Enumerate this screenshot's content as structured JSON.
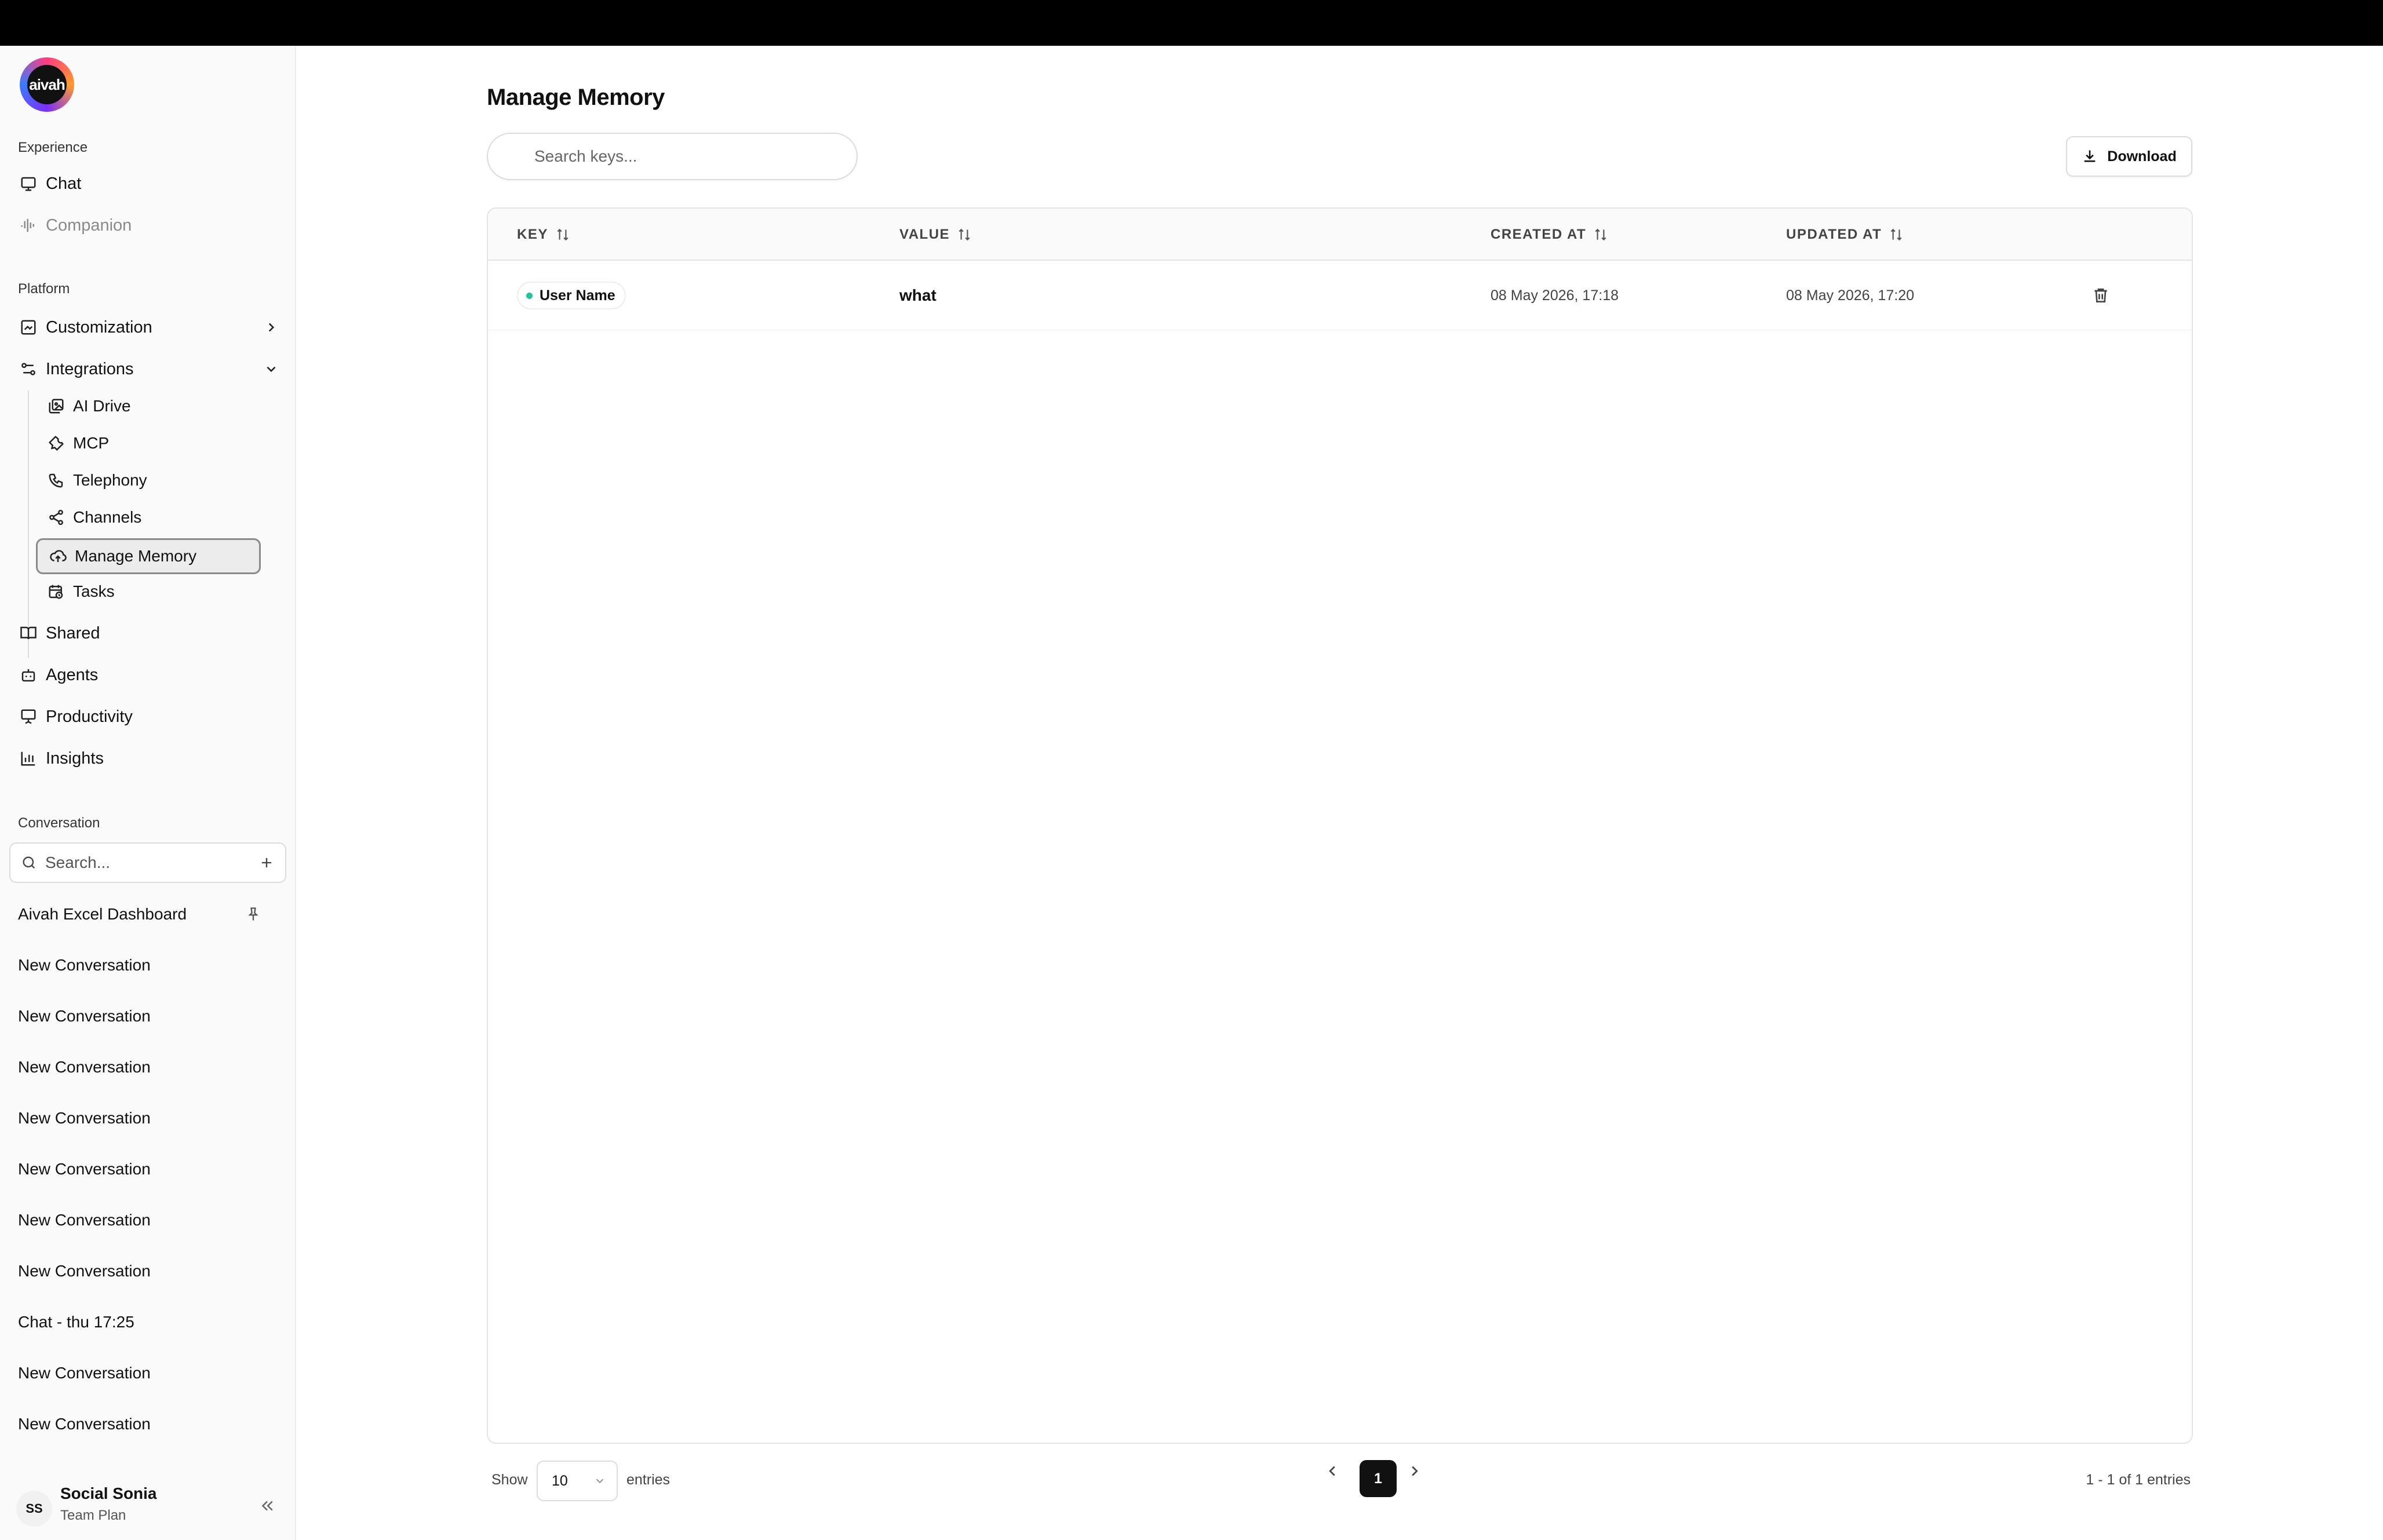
{
  "brand": {
    "logo_text": "aivah"
  },
  "sidebar": {
    "experience_label": "Experience",
    "experience_items": [
      {
        "label": "Chat",
        "icon": "chat-icon"
      },
      {
        "label": "Companion",
        "icon": "waveform-icon"
      }
    ],
    "platform_label": "Platform",
    "platform_items": [
      {
        "label": "Customization",
        "icon": "customization-icon"
      },
      {
        "label": "Integrations",
        "icon": "integrations-icon"
      }
    ],
    "integrations_sub": [
      {
        "label": "AI Drive",
        "icon": "drive-icon"
      },
      {
        "label": "MCP",
        "icon": "wrench-icon"
      },
      {
        "label": "Telephony",
        "icon": "phone-icon"
      },
      {
        "label": "Channels",
        "icon": "share-icon"
      },
      {
        "label": "Manage Memory",
        "icon": "cloud-icon"
      },
      {
        "label": "Tasks",
        "icon": "calendar-clock-icon"
      }
    ],
    "more_items": [
      {
        "label": "Shared",
        "icon": "book-icon"
      },
      {
        "label": "Agents",
        "icon": "bot-icon"
      },
      {
        "label": "Productivity",
        "icon": "presentation-icon"
      },
      {
        "label": "Insights",
        "icon": "bar-chart-icon"
      }
    ],
    "conversation_label": "Conversation",
    "search_placeholder": "Search...",
    "conversations": [
      "Aivah Excel Dashboard",
      "New Conversation",
      "New Conversation",
      "New Conversation",
      "New Conversation",
      "New Conversation",
      "New Conversation",
      "New Conversation",
      "Chat - thu 17:25",
      "New Conversation",
      "New Conversation"
    ],
    "user": {
      "initials": "SS",
      "name": "Social Sonia",
      "plan": "Team Plan"
    }
  },
  "main": {
    "title": "Manage Memory",
    "search_placeholder": "Search keys...",
    "download_label": "Download",
    "columns": [
      "KEY",
      "VALUE",
      "CREATED AT",
      "UPDATED AT"
    ],
    "rows": [
      {
        "key": "User Name",
        "value": "what",
        "created": "08 May 2026, 17:18",
        "updated": "08 May 2026, 17:20"
      }
    ],
    "pagination": {
      "show_label": "Show",
      "page_size": "10",
      "entries_label": "entries",
      "current_page": "1",
      "info": "1 - 1 of 1 entries"
    }
  },
  "colors": {
    "active_border": "#8a8a8a",
    "status_dot": "#22c39a",
    "topbar": "#000000"
  }
}
